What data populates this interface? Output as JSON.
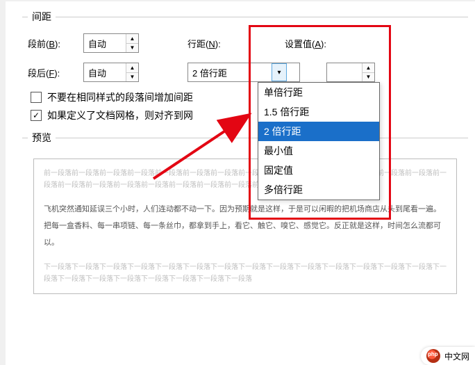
{
  "spacing": {
    "legend": "间距",
    "before_label": "段前(",
    "before_accel": "B",
    "before_label_end": "):",
    "before_value": "自动",
    "after_label": "段后(",
    "after_accel": "F",
    "after_label_end": "):",
    "after_value": "自动",
    "linespacing_label": "行距(",
    "linespacing_accel": "N",
    "linespacing_label_end": "):",
    "linespacing_value": "2 倍行距",
    "setvalue_label": "设置值(",
    "setvalue_accel": "A",
    "setvalue_label_end": "):",
    "setvalue_value": "",
    "options": {
      "o1": "单倍行距",
      "o2": "1.5 倍行距",
      "o3": "2 倍行距",
      "o4": "最小值",
      "o5": "固定值",
      "o6": "多倍行距"
    },
    "chk1": "不要在相同样式的段落间增加间距",
    "chk2": "如果定义了文档网格，则对齐到网"
  },
  "preview": {
    "legend": "预览",
    "before": "前一段落前一段落前一段落前一段落前一段落前一段落前一段落前一段落前一段落前一段落前一段落前一段落前一段落前一段落前一段落前一段落前一段落前一段落前一段落前一段落前一段落前一段落前一段落前一段落",
    "body": "飞机突然通知延误三个小时，人们连动都不动一下。因为预期就是这样，于是可以闲暇的把机场商店从头到尾看一遍。把每一盒香料、每一串项链、每一条丝巾，都拿到手上，看它、触它、嗅它、感觉它。反正就是这样，时间怎么流都可以。",
    "after": "下一段落下一段落下一段落下一段落下一段落下一段落下一段落下一段落下一段落下一段落下一段落下一段落下一段落下一段落下一段落下一段落下一段落下一段落下一段落下一段落下一段落下一段落"
  },
  "watermark": "中文网"
}
